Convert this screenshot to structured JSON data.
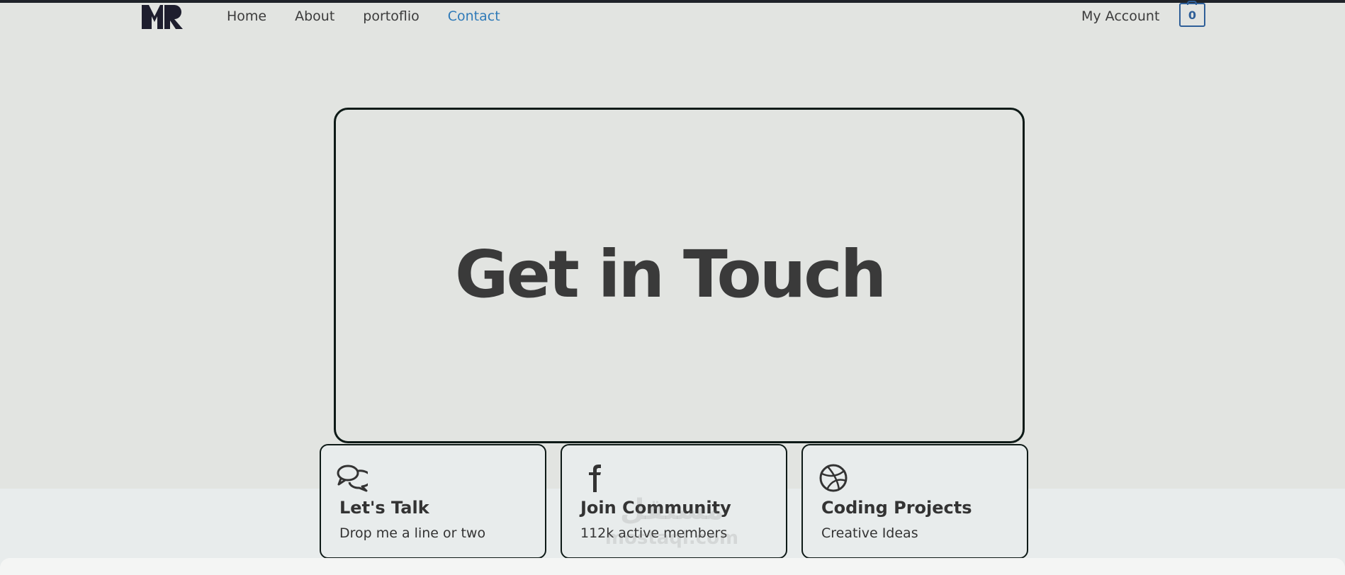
{
  "nav": {
    "items": [
      {
        "label": "Home"
      },
      {
        "label": "About"
      },
      {
        "label": "portoflio"
      },
      {
        "label": "Contact"
      }
    ],
    "active": "Contact"
  },
  "account": {
    "label": "My Account"
  },
  "cart": {
    "count": "0"
  },
  "hero": {
    "title": "Get in Touch"
  },
  "cards": [
    {
      "icon": "chat-bubbles-icon",
      "title": "Let's Talk",
      "subtitle": "Drop me a line or two"
    },
    {
      "icon": "facebook-icon",
      "title": "Join Community",
      "subtitle": "112k active members"
    },
    {
      "icon": "dribbble-icon",
      "title": "Coding Projects",
      "subtitle": "Creative Ideas"
    }
  ],
  "watermark": {
    "text": "mostaql.com"
  },
  "colors": {
    "accent": "#2f7ab8",
    "cart": "#2f5f98",
    "border": "#0e1a17",
    "background": "#e2e4e1"
  }
}
